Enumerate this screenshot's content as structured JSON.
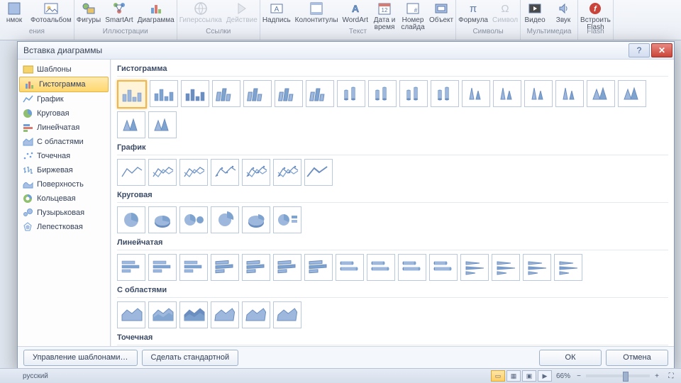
{
  "ribbon": {
    "groups": [
      {
        "label": "ения",
        "buttons": [
          {
            "name": "clip",
            "label": "нмок",
            "dis": false
          },
          {
            "name": "photoalbum",
            "label": "Фотоальбом",
            "dis": false
          }
        ]
      },
      {
        "label": "Иллюстрации",
        "buttons": [
          {
            "name": "shapes",
            "label": "Фигуры",
            "dis": false
          },
          {
            "name": "smartart",
            "label": "SmartArt",
            "dis": false
          },
          {
            "name": "chart",
            "label": "Диаграмма",
            "dis": false
          }
        ]
      },
      {
        "label": "Ссылки",
        "buttons": [
          {
            "name": "hyperlink",
            "label": "Гиперссылка",
            "dis": true
          },
          {
            "name": "action",
            "label": "Действие",
            "dis": true
          }
        ]
      },
      {
        "label": "Текст",
        "buttons": [
          {
            "name": "textbox",
            "label": "Надпись",
            "dis": false
          },
          {
            "name": "headerfooter",
            "label": "Колонтитулы",
            "dis": false
          },
          {
            "name": "wordart",
            "label": "WordArt",
            "dis": false
          },
          {
            "name": "datetime",
            "label": "Дата и\nвремя",
            "dis": false
          },
          {
            "name": "slidenumber",
            "label": "Номер\nслайда",
            "dis": false
          },
          {
            "name": "object",
            "label": "Объект",
            "dis": false
          }
        ]
      },
      {
        "label": "Символы",
        "buttons": [
          {
            "name": "equation",
            "label": "Формула",
            "dis": false
          },
          {
            "name": "symbol",
            "label": "Символ",
            "dis": true
          }
        ]
      },
      {
        "label": "Мультимедиа",
        "buttons": [
          {
            "name": "video",
            "label": "Видео",
            "dis": false
          },
          {
            "name": "audio",
            "label": "Звук",
            "dis": false
          }
        ]
      },
      {
        "label": "Flash",
        "buttons": [
          {
            "name": "flash",
            "label": "Встроить\nFlash",
            "dis": false
          }
        ]
      }
    ]
  },
  "dialog": {
    "title": "Вставка диаграммы",
    "categories": [
      {
        "name": "templates",
        "label": "Шаблоны",
        "sel": false
      },
      {
        "name": "column",
        "label": "Гистограмма",
        "sel": true
      },
      {
        "name": "line",
        "label": "График",
        "sel": false
      },
      {
        "name": "pie",
        "label": "Круговая",
        "sel": false
      },
      {
        "name": "bar",
        "label": "Линейчатая",
        "sel": false
      },
      {
        "name": "area",
        "label": "С областями",
        "sel": false
      },
      {
        "name": "scatter",
        "label": "Точечная",
        "sel": false
      },
      {
        "name": "stock",
        "label": "Биржевая",
        "sel": false
      },
      {
        "name": "surface",
        "label": "Поверхность",
        "sel": false
      },
      {
        "name": "doughnut",
        "label": "Кольцевая",
        "sel": false
      },
      {
        "name": "bubble",
        "label": "Пузырьковая",
        "sel": false
      },
      {
        "name": "radar",
        "label": "Лепестковая",
        "sel": false
      }
    ],
    "sections": [
      {
        "name": "column",
        "label": "Гистограмма",
        "count": 19,
        "selected": 0
      },
      {
        "name": "line",
        "label": "График",
        "count": 7,
        "selected": -1
      },
      {
        "name": "pie",
        "label": "Круговая",
        "count": 6,
        "selected": -1
      },
      {
        "name": "bar",
        "label": "Линейчатая",
        "count": 15,
        "selected": -1
      },
      {
        "name": "area",
        "label": "С областями",
        "count": 6,
        "selected": -1
      },
      {
        "name": "scatter",
        "label": "Точечная",
        "count": 5,
        "selected": -1
      }
    ],
    "footer": {
      "manage": "Управление шаблонами…",
      "default": "Сделать стандартной",
      "ok": "ОК",
      "cancel": "Отмена"
    }
  },
  "status": {
    "lang": "русский",
    "zoom": "66%"
  }
}
